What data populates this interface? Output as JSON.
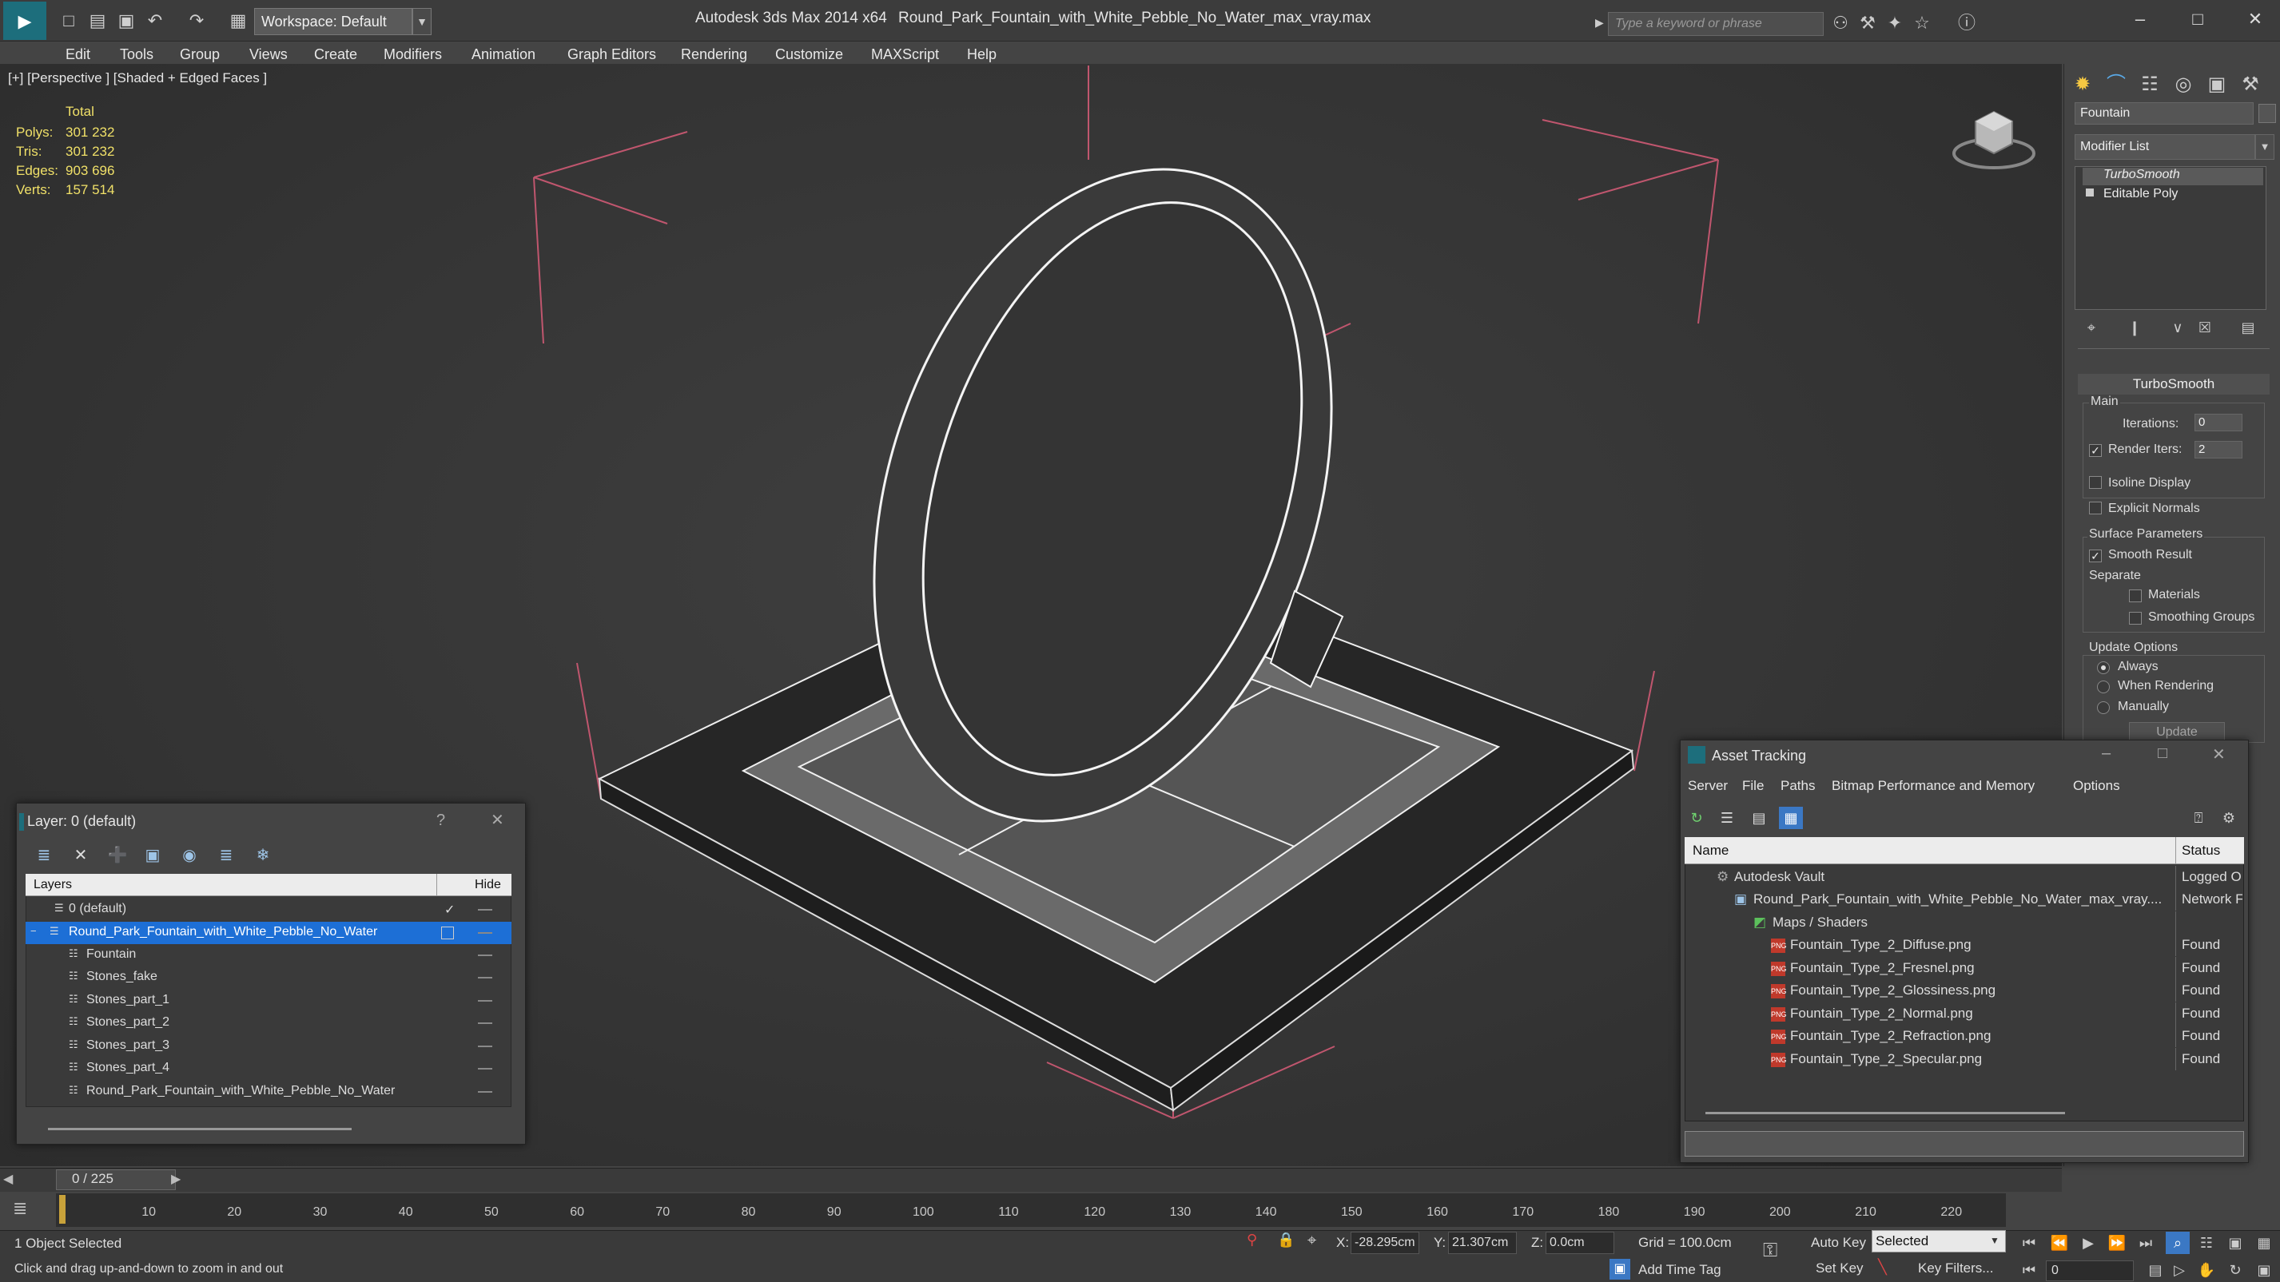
{
  "titlebar": {
    "workspace": "Workspace: Default",
    "app_title": "Autodesk 3ds Max  2014 x64",
    "file_title": "Round_Park_Fountain_with_White_Pebble_No_Water_max_vray.max",
    "search_placeholder": "Type a keyword or phrase"
  },
  "menu": [
    "Edit",
    "Tools",
    "Group",
    "Views",
    "Create",
    "Modifiers",
    "Animation",
    "Graph Editors",
    "Rendering",
    "Customize",
    "MAXScript",
    "Help"
  ],
  "viewport": {
    "label": "[+] [Perspective ] [Shaded + Edged Faces ]",
    "stats_total": "Total",
    "stats": [
      {
        "label": "Polys:",
        "value": "301 232"
      },
      {
        "label": "Tris:",
        "value": "301 232"
      },
      {
        "label": "Edges:",
        "value": "903 696"
      },
      {
        "label": "Verts:",
        "value": "157 514"
      }
    ]
  },
  "command_panel": {
    "object_name": "Fountain",
    "modifier_list": "Modifier List",
    "stack": [
      "TurboSmooth",
      "Editable Poly"
    ],
    "rollout_title": "TurboSmooth",
    "main_label": "Main",
    "iterations_label": "Iterations:",
    "iterations_value": "0",
    "render_iters_label": "Render Iters:",
    "render_iters_value": "2",
    "isoline": "Isoline Display",
    "explicit_normals": "Explicit Normals",
    "surface_params": "Surface Parameters",
    "smooth_result": "Smooth Result",
    "separate": "Separate",
    "materials": "Materials",
    "smoothing_groups": "Smoothing Groups",
    "update_options": "Update Options",
    "always": "Always",
    "when_rendering": "When Rendering",
    "manually": "Manually",
    "update_btn": "Update"
  },
  "layer_dialog": {
    "title": "Layer: 0 (default)",
    "help": "?",
    "col_layers": "Layers",
    "col_hide": "Hide",
    "rows": [
      {
        "name": "0 (default)"
      },
      {
        "name": "Round_Park_Fountain_with_White_Pebble_No_Water"
      },
      {
        "name": "Fountain"
      },
      {
        "name": "Stones_fake"
      },
      {
        "name": "Stones_part_1"
      },
      {
        "name": "Stones_part_2"
      },
      {
        "name": "Stones_part_3"
      },
      {
        "name": "Stones_part_4"
      },
      {
        "name": "Round_Park_Fountain_with_White_Pebble_No_Water"
      }
    ]
  },
  "asset_tracking": {
    "title": "Asset Tracking",
    "menu": [
      "Server",
      "File",
      "Paths",
      "Bitmap Performance and Memory",
      "Options"
    ],
    "col_name": "Name",
    "col_status": "Status",
    "rows": [
      {
        "name": "Autodesk Vault",
        "status": "Logged O"
      },
      {
        "name": "Round_Park_Fountain_with_White_Pebble_No_Water_max_vray....",
        "status": "Network F"
      },
      {
        "name": "Maps / Shaders",
        "status": ""
      },
      {
        "name": "Fountain_Type_2_Diffuse.png",
        "status": "Found"
      },
      {
        "name": "Fountain_Type_2_Fresnel.png",
        "status": "Found"
      },
      {
        "name": "Fountain_Type_2_Glossiness.png",
        "status": "Found"
      },
      {
        "name": "Fountain_Type_2_Normal.png",
        "status": "Found"
      },
      {
        "name": "Fountain_Type_2_Refraction.png",
        "status": "Found"
      },
      {
        "name": "Fountain_Type_2_Specular.png",
        "status": "Found"
      }
    ]
  },
  "timeline": {
    "frame": "0 / 225",
    "ticks": [
      "10",
      "20",
      "30",
      "40",
      "50",
      "60",
      "70",
      "80",
      "90",
      "100",
      "110",
      "120",
      "130",
      "140",
      "150",
      "160",
      "170",
      "180",
      "190",
      "200",
      "210",
      "220"
    ]
  },
  "statusbar": {
    "selection": "1 Object Selected",
    "prompt": "Click and drag up-and-down to zoom in and out",
    "x_label": "X:",
    "x_value": "-28.295cm",
    "y_label": "Y:",
    "y_value": "21.307cm",
    "z_label": "Z:",
    "z_value": "0.0cm",
    "grid": "Grid = 100.0cm",
    "auto_key": "Auto Key",
    "selected": "Selected",
    "set_key": "Set Key",
    "key_filters": "Key Filters...",
    "add_time_tag": "Add Time Tag",
    "frame_value": "0"
  }
}
